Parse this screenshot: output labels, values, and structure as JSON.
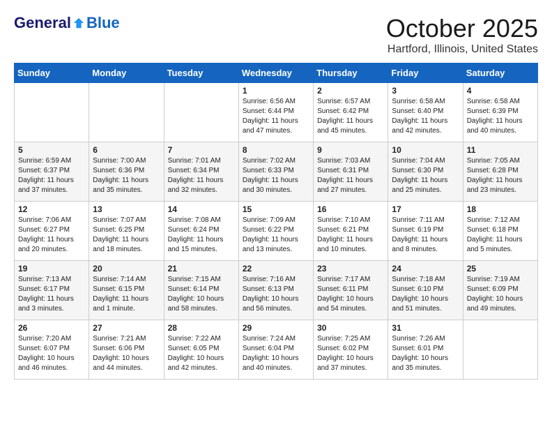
{
  "header": {
    "logo_general": "General",
    "logo_blue": "Blue",
    "month_title": "October 2025",
    "location": "Hartford, Illinois, United States"
  },
  "calendar": {
    "days_of_week": [
      "Sunday",
      "Monday",
      "Tuesday",
      "Wednesday",
      "Thursday",
      "Friday",
      "Saturday"
    ],
    "weeks": [
      [
        {
          "day": "",
          "info": ""
        },
        {
          "day": "",
          "info": ""
        },
        {
          "day": "",
          "info": ""
        },
        {
          "day": "1",
          "info": "Sunrise: 6:56 AM\nSunset: 6:44 PM\nDaylight: 11 hours and 47 minutes."
        },
        {
          "day": "2",
          "info": "Sunrise: 6:57 AM\nSunset: 6:42 PM\nDaylight: 11 hours and 45 minutes."
        },
        {
          "day": "3",
          "info": "Sunrise: 6:58 AM\nSunset: 6:40 PM\nDaylight: 11 hours and 42 minutes."
        },
        {
          "day": "4",
          "info": "Sunrise: 6:58 AM\nSunset: 6:39 PM\nDaylight: 11 hours and 40 minutes."
        }
      ],
      [
        {
          "day": "5",
          "info": "Sunrise: 6:59 AM\nSunset: 6:37 PM\nDaylight: 11 hours and 37 minutes."
        },
        {
          "day": "6",
          "info": "Sunrise: 7:00 AM\nSunset: 6:36 PM\nDaylight: 11 hours and 35 minutes."
        },
        {
          "day": "7",
          "info": "Sunrise: 7:01 AM\nSunset: 6:34 PM\nDaylight: 11 hours and 32 minutes."
        },
        {
          "day": "8",
          "info": "Sunrise: 7:02 AM\nSunset: 6:33 PM\nDaylight: 11 hours and 30 minutes."
        },
        {
          "day": "9",
          "info": "Sunrise: 7:03 AM\nSunset: 6:31 PM\nDaylight: 11 hours and 27 minutes."
        },
        {
          "day": "10",
          "info": "Sunrise: 7:04 AM\nSunset: 6:30 PM\nDaylight: 11 hours and 25 minutes."
        },
        {
          "day": "11",
          "info": "Sunrise: 7:05 AM\nSunset: 6:28 PM\nDaylight: 11 hours and 23 minutes."
        }
      ],
      [
        {
          "day": "12",
          "info": "Sunrise: 7:06 AM\nSunset: 6:27 PM\nDaylight: 11 hours and 20 minutes."
        },
        {
          "day": "13",
          "info": "Sunrise: 7:07 AM\nSunset: 6:25 PM\nDaylight: 11 hours and 18 minutes."
        },
        {
          "day": "14",
          "info": "Sunrise: 7:08 AM\nSunset: 6:24 PM\nDaylight: 11 hours and 15 minutes."
        },
        {
          "day": "15",
          "info": "Sunrise: 7:09 AM\nSunset: 6:22 PM\nDaylight: 11 hours and 13 minutes."
        },
        {
          "day": "16",
          "info": "Sunrise: 7:10 AM\nSunset: 6:21 PM\nDaylight: 11 hours and 10 minutes."
        },
        {
          "day": "17",
          "info": "Sunrise: 7:11 AM\nSunset: 6:19 PM\nDaylight: 11 hours and 8 minutes."
        },
        {
          "day": "18",
          "info": "Sunrise: 7:12 AM\nSunset: 6:18 PM\nDaylight: 11 hours and 5 minutes."
        }
      ],
      [
        {
          "day": "19",
          "info": "Sunrise: 7:13 AM\nSunset: 6:17 PM\nDaylight: 11 hours and 3 minutes."
        },
        {
          "day": "20",
          "info": "Sunrise: 7:14 AM\nSunset: 6:15 PM\nDaylight: 11 hours and 1 minute."
        },
        {
          "day": "21",
          "info": "Sunrise: 7:15 AM\nSunset: 6:14 PM\nDaylight: 10 hours and 58 minutes."
        },
        {
          "day": "22",
          "info": "Sunrise: 7:16 AM\nSunset: 6:13 PM\nDaylight: 10 hours and 56 minutes."
        },
        {
          "day": "23",
          "info": "Sunrise: 7:17 AM\nSunset: 6:11 PM\nDaylight: 10 hours and 54 minutes."
        },
        {
          "day": "24",
          "info": "Sunrise: 7:18 AM\nSunset: 6:10 PM\nDaylight: 10 hours and 51 minutes."
        },
        {
          "day": "25",
          "info": "Sunrise: 7:19 AM\nSunset: 6:09 PM\nDaylight: 10 hours and 49 minutes."
        }
      ],
      [
        {
          "day": "26",
          "info": "Sunrise: 7:20 AM\nSunset: 6:07 PM\nDaylight: 10 hours and 46 minutes."
        },
        {
          "day": "27",
          "info": "Sunrise: 7:21 AM\nSunset: 6:06 PM\nDaylight: 10 hours and 44 minutes."
        },
        {
          "day": "28",
          "info": "Sunrise: 7:22 AM\nSunset: 6:05 PM\nDaylight: 10 hours and 42 minutes."
        },
        {
          "day": "29",
          "info": "Sunrise: 7:24 AM\nSunset: 6:04 PM\nDaylight: 10 hours and 40 minutes."
        },
        {
          "day": "30",
          "info": "Sunrise: 7:25 AM\nSunset: 6:02 PM\nDaylight: 10 hours and 37 minutes."
        },
        {
          "day": "31",
          "info": "Sunrise: 7:26 AM\nSunset: 6:01 PM\nDaylight: 10 hours and 35 minutes."
        },
        {
          "day": "",
          "info": ""
        }
      ]
    ]
  }
}
